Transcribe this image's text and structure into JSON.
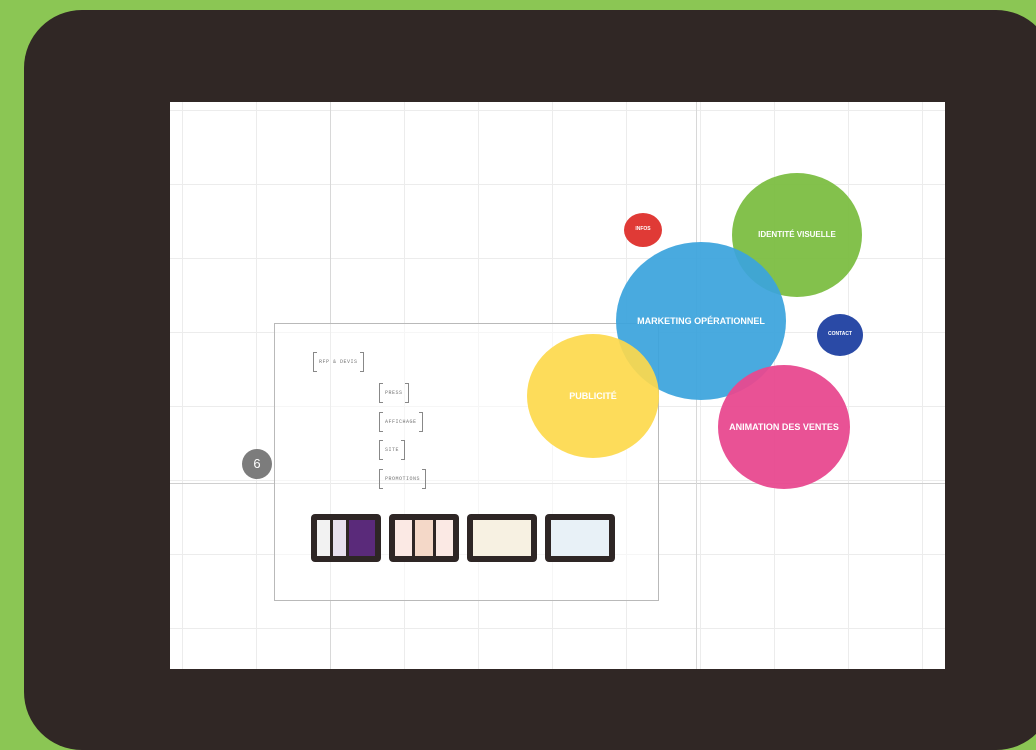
{
  "step": {
    "number": "6"
  },
  "frame": {
    "root_tag": "RFP & DEVIS",
    "tags": [
      "PRESS",
      "AFFICHAGE",
      "SITE",
      "PROMOTIONS"
    ]
  },
  "bubbles": {
    "green": "IDENTITÉ VISUELLE",
    "blue": "MARKETING OPÉRATIONNEL",
    "yellow": "PUBLICITÉ",
    "pink": "ANIMATION DES VENTES",
    "red": "INFOS",
    "navy": "CONTACT"
  },
  "colors": {
    "background": "#8bc654",
    "tablet": "#302725",
    "green": "#7cbe42",
    "blue": "#3ba4dd",
    "yellow": "#fdd94c",
    "pink": "#e8498f",
    "red": "#e03a36",
    "navy": "#2a4aa6"
  },
  "thumbnails": [
    {
      "name": "thumb-1"
    },
    {
      "name": "thumb-2"
    },
    {
      "name": "thumb-3"
    },
    {
      "name": "thumb-4"
    }
  ]
}
